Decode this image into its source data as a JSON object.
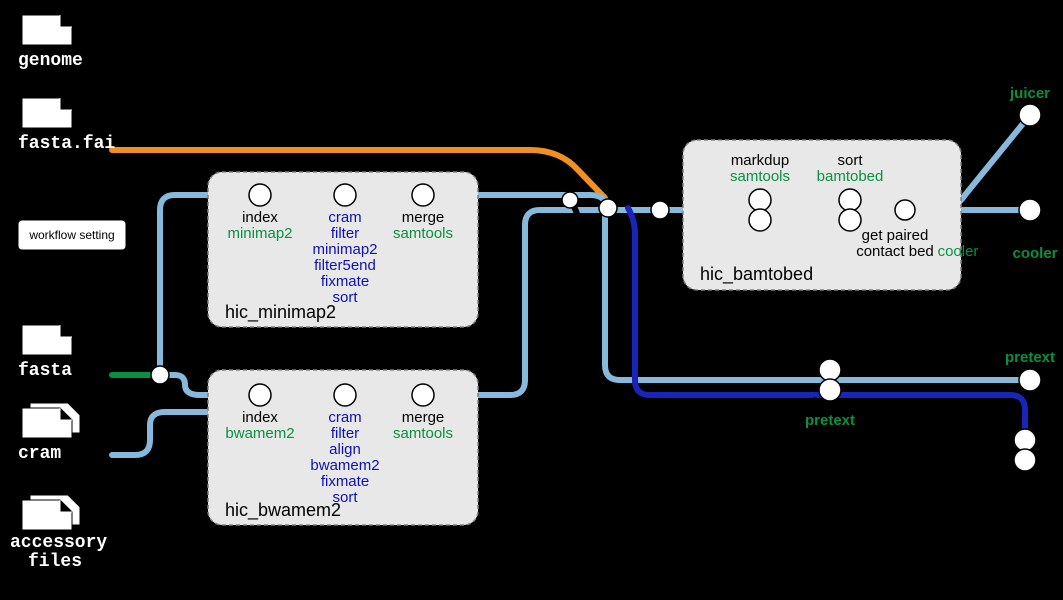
{
  "inputs": {
    "genome": "genome",
    "fastafai": "fasta.fai",
    "fasta": "fasta",
    "cram": "cram",
    "accessory": "accessory",
    "files": "files"
  },
  "workflow_setting": "workflow setting",
  "proc_minimap2": {
    "title": "hic_minimap2",
    "index_label": "index",
    "index_tool": "minimap2",
    "mid_lines": [
      "cram",
      "filter",
      "minimap2",
      "filter5end",
      "fixmate",
      "sort"
    ],
    "merge_label": "merge",
    "merge_tool": "samtools"
  },
  "proc_bwamem2": {
    "title": "hic_bwamem2",
    "index_label": "index",
    "index_tool": "bwamem2",
    "mid_lines": [
      "cram",
      "filter",
      "align",
      "bwamem2",
      "fixmate",
      "sort"
    ],
    "merge_label": "merge",
    "merge_tool": "samtools"
  },
  "proc_bamtobed": {
    "title": "hic_bamtobed",
    "markdup_label": "markdup",
    "markdup_tool": "samtools",
    "sort_label": "sort",
    "sort_tool": "bamtobed",
    "paired_l1": "get paired",
    "paired_l2": "contact bed"
  },
  "outputs": {
    "juicer": "juicer",
    "cooler_box": "cooler",
    "cooler_out": "cooler",
    "pretext": "pretext",
    "pretext2": "pretext"
  }
}
